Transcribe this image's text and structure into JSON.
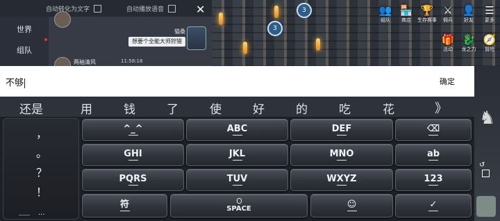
{
  "chat": {
    "auto_text_label": "自动转化为文字",
    "auto_voice_label": "自动播放语音",
    "tabs": [
      "世界",
      "组队"
    ],
    "messages": [
      {
        "sender": "猫桑",
        "text": "想要个全能大师狩猎"
      },
      {
        "sender": "两袖清风",
        "time": "11:58:18"
      }
    ]
  },
  "game": {
    "top_icons": [
      {
        "label": "组队",
        "icon": "team-icon",
        "glyph": "👥"
      },
      {
        "label": "商店",
        "icon": "shop-icon",
        "glyph": "🏪"
      },
      {
        "label": "生存赛事",
        "icon": "trophy-icon",
        "glyph": "🏆"
      },
      {
        "label": "佣兵",
        "icon": "mercenary-icon",
        "glyph": "⚔"
      },
      {
        "label": "好友",
        "icon": "friends-icon",
        "glyph": "👤"
      },
      {
        "label": "更多",
        "icon": "more-icon",
        "glyph": "☰"
      }
    ],
    "second_icons": [
      {
        "label": "活动",
        "icon": "event-icon",
        "glyph": "🎁"
      },
      {
        "label": "龙之力",
        "icon": "dragon-icon",
        "glyph": "🐉"
      },
      {
        "label": "冒险",
        "icon": "adventure-icon",
        "glyph": "🧭"
      }
    ],
    "bubbles": [
      "3",
      "3"
    ]
  },
  "input": {
    "value": "不够",
    "confirm_label": "确定"
  },
  "candidates": [
    "还是",
    "用",
    "钱",
    "了",
    "使",
    "好",
    "的",
    "吃",
    "花"
  ],
  "candidates_more": "》",
  "keyboard": {
    "punctuation": [
      "，",
      "。",
      "？",
      "！"
    ],
    "punctuation_more": "...",
    "rows": [
      [
        "^_^",
        "ABC",
        "DEF",
        "⌫"
      ],
      [
        "GHI",
        "JKL",
        "MNO",
        "ab"
      ],
      [
        "PQRS",
        "TUV",
        "WXYZ",
        "123"
      ]
    ],
    "bottom": {
      "symbols": "符",
      "space": "SPACE",
      "emoji": "☺",
      "enter": "✓"
    }
  }
}
